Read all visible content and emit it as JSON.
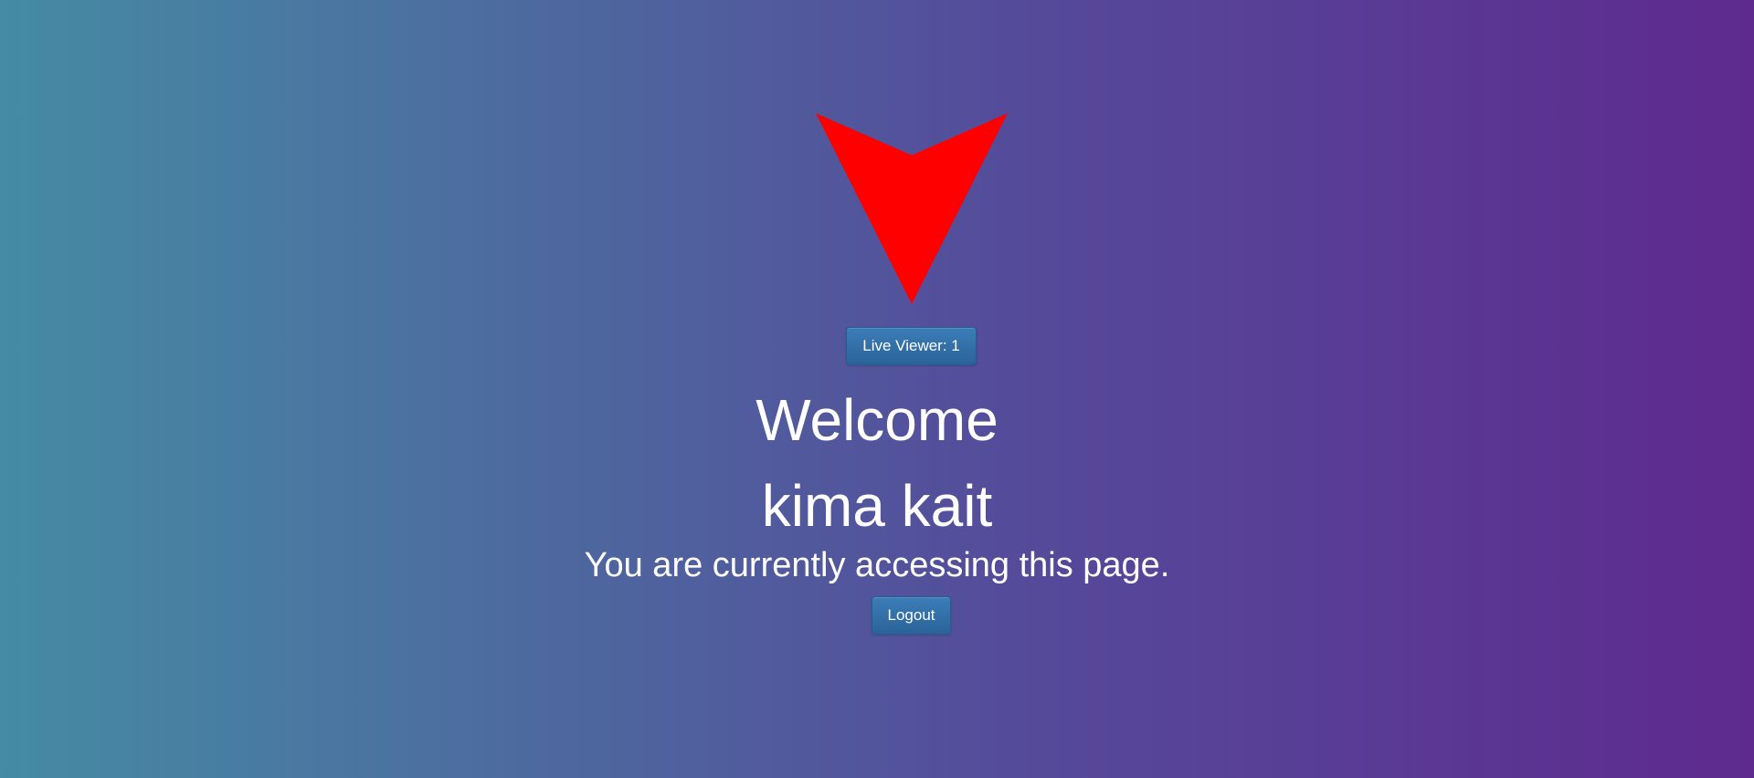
{
  "colors": {
    "background_start": "#458ba4",
    "background_end": "#5e2a8e",
    "arrow": "#ff0000",
    "button": "#2f6da6",
    "text": "#ffffff"
  },
  "icons": {
    "arrow": "down-arrow-icon"
  },
  "live_viewer": {
    "label": "Live Viewer: 1"
  },
  "greeting": {
    "welcome": "Welcome",
    "username": "kima kait",
    "message": "You are currently accessing this page."
  },
  "actions": {
    "logout_label": "Logout"
  }
}
